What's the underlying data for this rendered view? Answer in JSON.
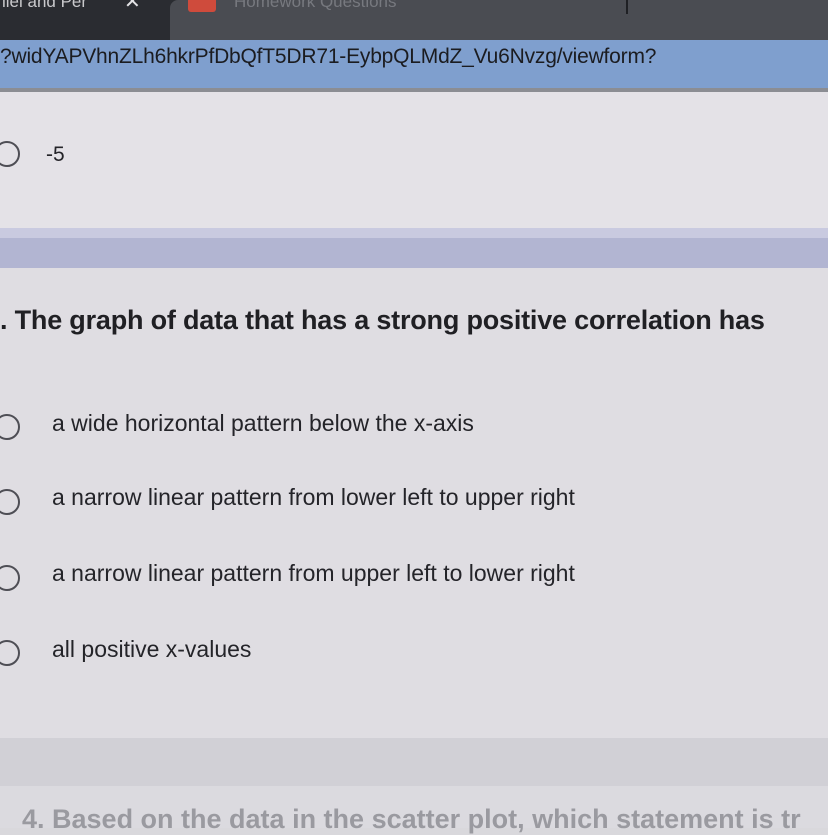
{
  "browser": {
    "tab_left_title": "llel and Per",
    "tab_close_glyph": "✕",
    "tab_right_title": "Homework Questions",
    "url": "?widYAPVhnZLh6hkrPfDbQfT5DR71-EybpQLMdZ_Vu6Nvzg/viewform?"
  },
  "previous_question": {
    "option_label": "-5"
  },
  "question": {
    "text": ". The graph of data that has a strong positive correlation has",
    "options": [
      {
        "label": "a wide horizontal pattern below the x-axis"
      },
      {
        "label": "a narrow linear pattern from lower left to upper right"
      },
      {
        "label": "a narrow linear pattern from upper left to lower right"
      },
      {
        "label": "all positive x-values"
      }
    ]
  },
  "next_question": {
    "text": "4. Based on the data in the scatter plot, which statement is tr"
  }
}
